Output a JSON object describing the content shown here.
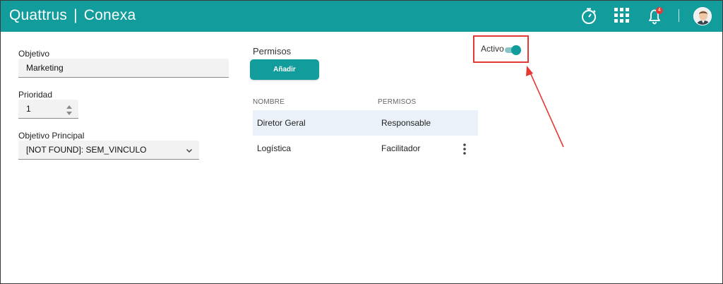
{
  "header": {
    "brand_left": "Quattrus",
    "brand_sep": "|",
    "brand_right": "Conexa",
    "icons": [
      "stopwatch-icon",
      "apps-grid-icon",
      "bell-icon",
      "user-avatar"
    ],
    "notification_count": "4"
  },
  "form": {
    "objetivo_label": "Objetivo",
    "objetivo_value": "Marketing",
    "prioridad_label": "Prioridad",
    "prioridad_value": "1",
    "principal_label": "Objetivo Principal",
    "principal_value": "[NOT FOUND]: SEM_VINCULO"
  },
  "permisos": {
    "title": "Permisos",
    "add_button": "Añadir",
    "columns": [
      "NOMBRE",
      "PERMISOS"
    ],
    "rows": [
      {
        "nombre": "Diretor Geral",
        "permiso": "Responsable"
      },
      {
        "nombre": "Logística",
        "permiso": "Facilitador"
      }
    ]
  },
  "activo": {
    "label": "Activo",
    "on": true
  },
  "colors": {
    "accent": "#129c9c",
    "highlight_box": "#e53935",
    "row_highlight": "#eaf1f8"
  }
}
